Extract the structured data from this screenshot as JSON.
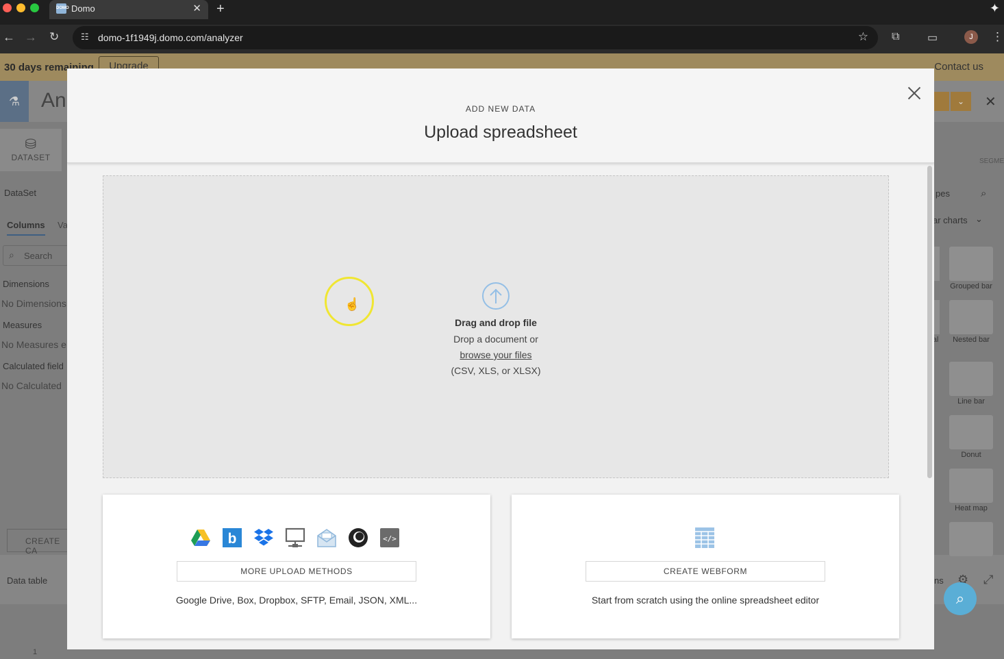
{
  "browser": {
    "tab_title": "Domo",
    "favicon_text": "DOMO",
    "url": "domo-1f1949j.domo.com/analyzer",
    "profile_initial": "J"
  },
  "app": {
    "trial_text": "30 days remaining",
    "upgrade_label": "Upgrade",
    "contact_label": "Contact us",
    "title_fragment": "An",
    "dataset_label": "DATASET",
    "dataset_section": "DataSet",
    "tab_columns": "Columns",
    "tab_values_fragment": "Va",
    "search_placeholder": "Search",
    "dimensions_label": "Dimensions",
    "no_dimensions": "No Dimensions",
    "measures_label": "Measures",
    "no_measures": "No Measures e",
    "calculated_label": "Calculated field",
    "no_calculated": "No Calculated",
    "create_btn_fragment": "CREATE CA",
    "data_table_label": "Data table",
    "row_number": "1",
    "right_panel_title_fragment": "pes",
    "right_panel_select_fragment": "ar charts",
    "segment_fragment": "SEGMENT",
    "chart_types": [
      {
        "label": "Grouped bar"
      },
      {
        "label": "Nested bar"
      },
      {
        "label": "Line bar"
      },
      {
        "label": "Donut"
      },
      {
        "label": "Heat map"
      }
    ],
    "chart_side_label_fragment": "al",
    "bottom_right_fragment": "ns"
  },
  "modal": {
    "eyebrow": "ADD NEW DATA",
    "title": "Upload spreadsheet",
    "dropzone": {
      "title": "Drag and drop file",
      "line1": "Drop a document or",
      "link": "browse your files",
      "formats": "(CSV, XLS, or XLSX)"
    },
    "more_upload": {
      "button_label": "MORE UPLOAD METHODS",
      "description": "Google Drive, Box, Dropbox, SFTP, Email, JSON, XML...",
      "icons": [
        "google-drive-icon",
        "box-icon",
        "dropbox-icon",
        "sftp-icon",
        "email-icon",
        "json-icon",
        "xml-icon"
      ]
    },
    "webform": {
      "button_label": "CREATE WEBFORM",
      "description": "Start from scratch using the online spreadsheet editor"
    }
  },
  "colors": {
    "accent_blue": "#94bfe6",
    "cursor_highlight": "#f0e632",
    "chat_fab": "#5aaed6"
  }
}
